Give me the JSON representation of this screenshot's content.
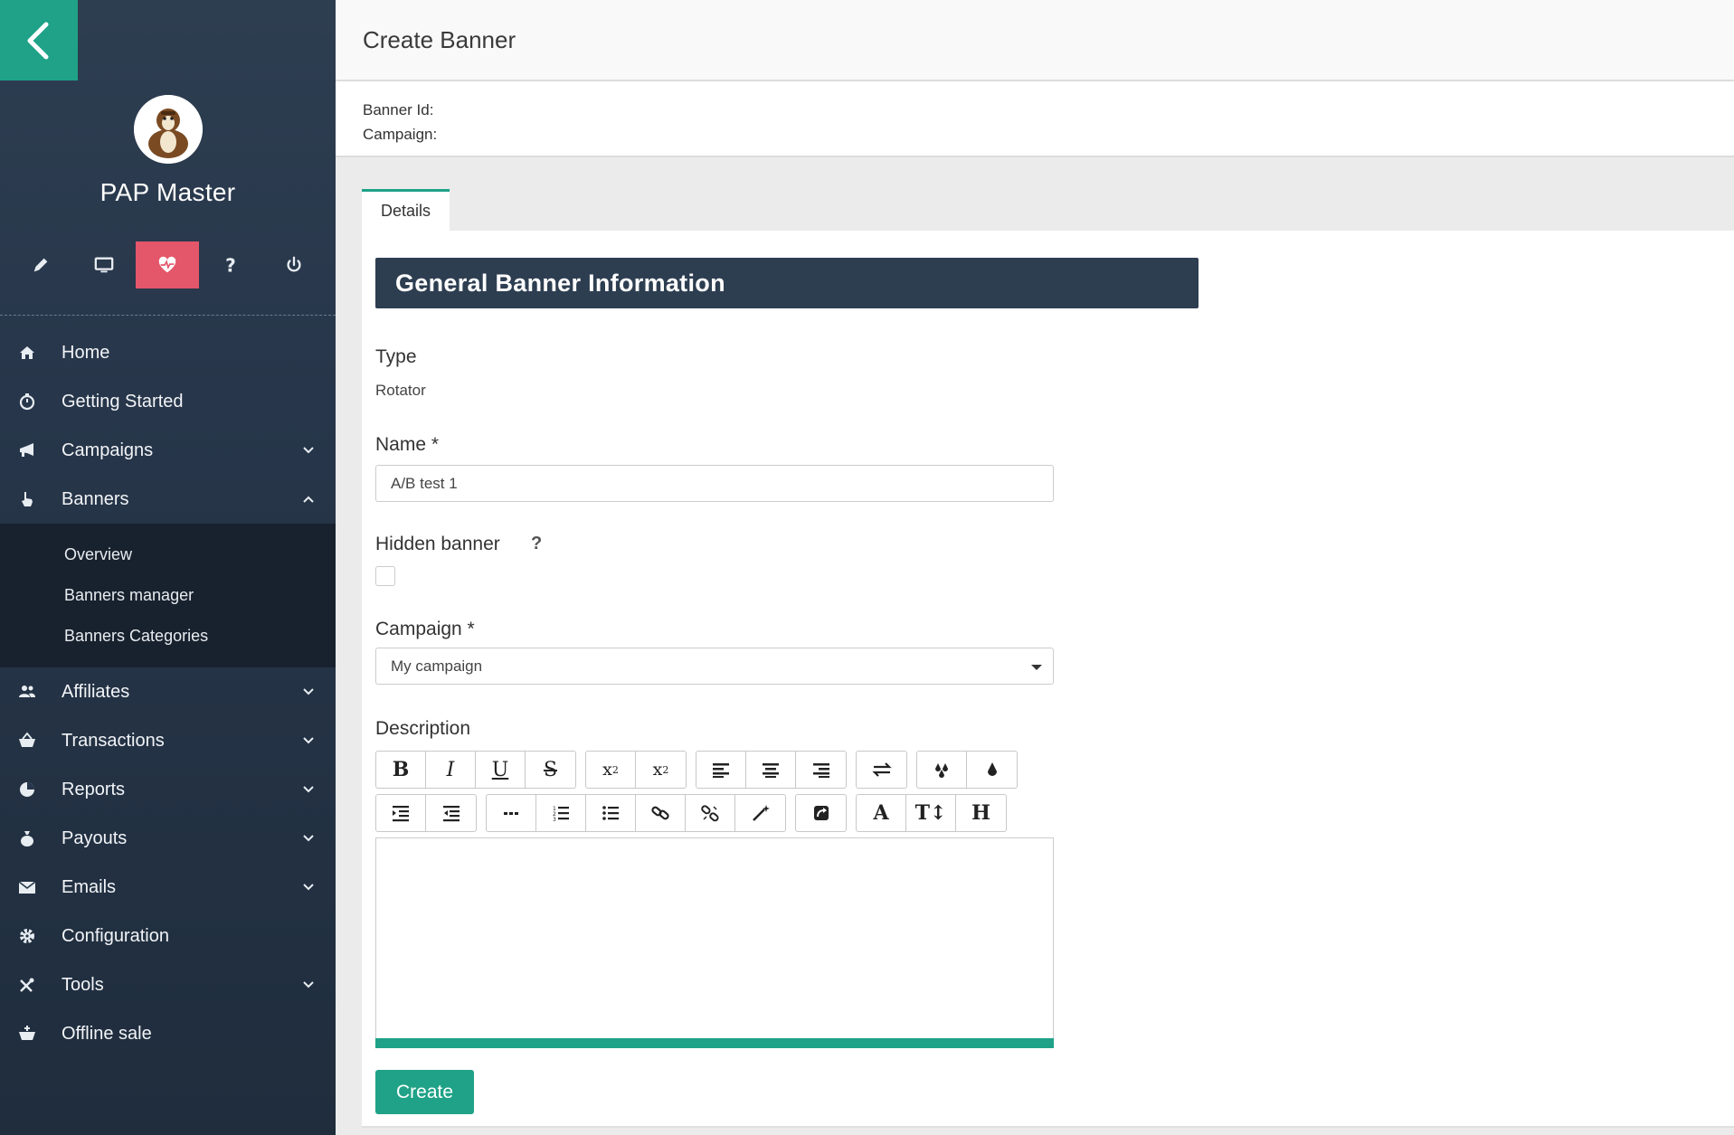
{
  "sidebar": {
    "profile_name": "PAP Master",
    "quick_icons": [
      "pencil-icon",
      "monitor-icon",
      "heartbeat-icon",
      "question-icon",
      "power-icon"
    ],
    "active_quick_icon": "heartbeat-icon",
    "nav": [
      {
        "label": "Home",
        "icon": "home-icon",
        "expandable": false
      },
      {
        "label": "Getting Started",
        "icon": "stopwatch-icon",
        "expandable": false
      },
      {
        "label": "Campaigns",
        "icon": "megaphone-icon",
        "expandable": true
      },
      {
        "label": "Banners",
        "icon": "hand-pointer-icon",
        "expandable": true,
        "expanded": true
      },
      {
        "label": "Affiliates",
        "icon": "users-icon",
        "expandable": true
      },
      {
        "label": "Transactions",
        "icon": "basket-icon",
        "expandable": true
      },
      {
        "label": "Reports",
        "icon": "pie-chart-icon",
        "expandable": true
      },
      {
        "label": "Payouts",
        "icon": "money-bag-icon",
        "expandable": true
      },
      {
        "label": "Emails",
        "icon": "envelope-icon",
        "expandable": true
      },
      {
        "label": "Configuration",
        "icon": "gear-icon",
        "expandable": false
      },
      {
        "label": "Tools",
        "icon": "tools-icon",
        "expandable": true
      },
      {
        "label": "Offline sale",
        "icon": "cart-plus-icon",
        "expandable": false
      }
    ],
    "banners_sub": [
      "Overview",
      "Banners manager",
      "Banners Categories"
    ]
  },
  "page": {
    "title": "Create Banner",
    "banner_id_label": "Banner Id:",
    "campaign_label": "Campaign:",
    "tab_details": "Details"
  },
  "form": {
    "section_title": "General Banner Information",
    "type_label": "Type",
    "type_value": "Rotator",
    "name_label": "Name *",
    "name_value": "A/B test 1",
    "hidden_label": "Hidden banner",
    "hidden_help": "?",
    "hidden_checked": false,
    "campaign_label": "Campaign *",
    "campaign_value": "My campaign",
    "description_label": "Description",
    "create_button": "Create"
  },
  "toolbar": {
    "row1": [
      [
        "bold-icon",
        "italic-icon",
        "underline-icon",
        "strikethrough-icon"
      ],
      [
        "subscript-icon",
        "superscript-icon"
      ],
      [
        "align-left-icon",
        "align-center-icon",
        "align-right-icon"
      ],
      [
        "text-direction-icon"
      ],
      [
        "text-color-icon",
        "background-color-icon"
      ]
    ],
    "row2": [
      [
        "indent-icon",
        "outdent-icon"
      ],
      [
        "horizontal-rule-icon",
        "ordered-list-icon",
        "unordered-list-icon",
        "link-icon",
        "unlink-icon",
        "magic-wand-icon"
      ],
      [
        "source-code-icon"
      ],
      [
        "font-family-icon",
        "font-size-icon",
        "heading-icon"
      ]
    ]
  },
  "colors": {
    "accent": "#1fa287",
    "sidebar": "#27364a",
    "active_icon": "#e4566a",
    "section_header": "#2e3e51"
  }
}
